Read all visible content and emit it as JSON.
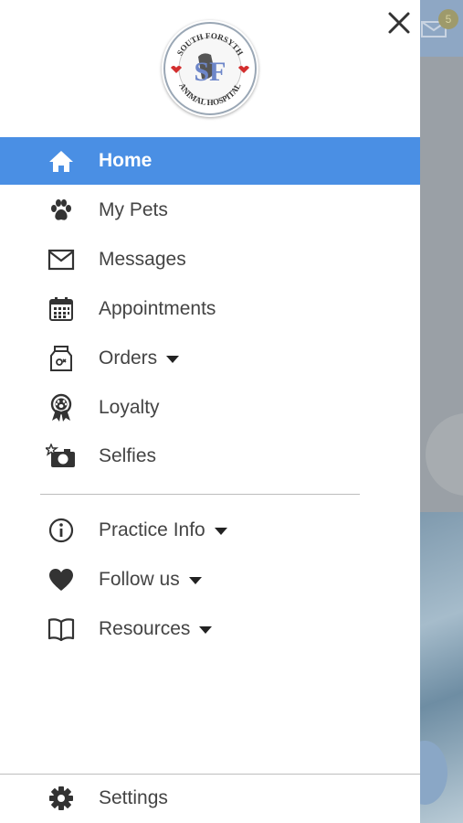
{
  "background": {
    "mail_badge_count": "5"
  },
  "logo": {
    "top_text": "SOUTH FORSYTH",
    "bottom_text": "ANIMAL HOSPITAL",
    "monogram": "SF"
  },
  "menu": {
    "items": [
      {
        "label": "Home",
        "icon": "home-icon",
        "active": true
      },
      {
        "label": "My Pets",
        "icon": "paw-icon"
      },
      {
        "label": "Messages",
        "icon": "envelope-icon"
      },
      {
        "label": "Appointments",
        "icon": "calendar-icon"
      },
      {
        "label": "Orders",
        "icon": "food-bag-icon",
        "dropdown": true
      },
      {
        "label": "Loyalty",
        "icon": "ribbon-award-icon"
      },
      {
        "label": "Selfies",
        "icon": "camera-star-icon"
      }
    ],
    "secondary": [
      {
        "label": "Practice Info",
        "icon": "info-icon",
        "dropdown": true
      },
      {
        "label": "Follow us",
        "icon": "heart-icon",
        "dropdown": true
      },
      {
        "label": "Resources",
        "icon": "book-icon",
        "dropdown": true
      }
    ],
    "settings": {
      "label": "Settings",
      "icon": "gear-icon"
    }
  },
  "colors": {
    "active_bg": "#4a8fe4",
    "icon": "#333333",
    "text": "#444444"
  }
}
